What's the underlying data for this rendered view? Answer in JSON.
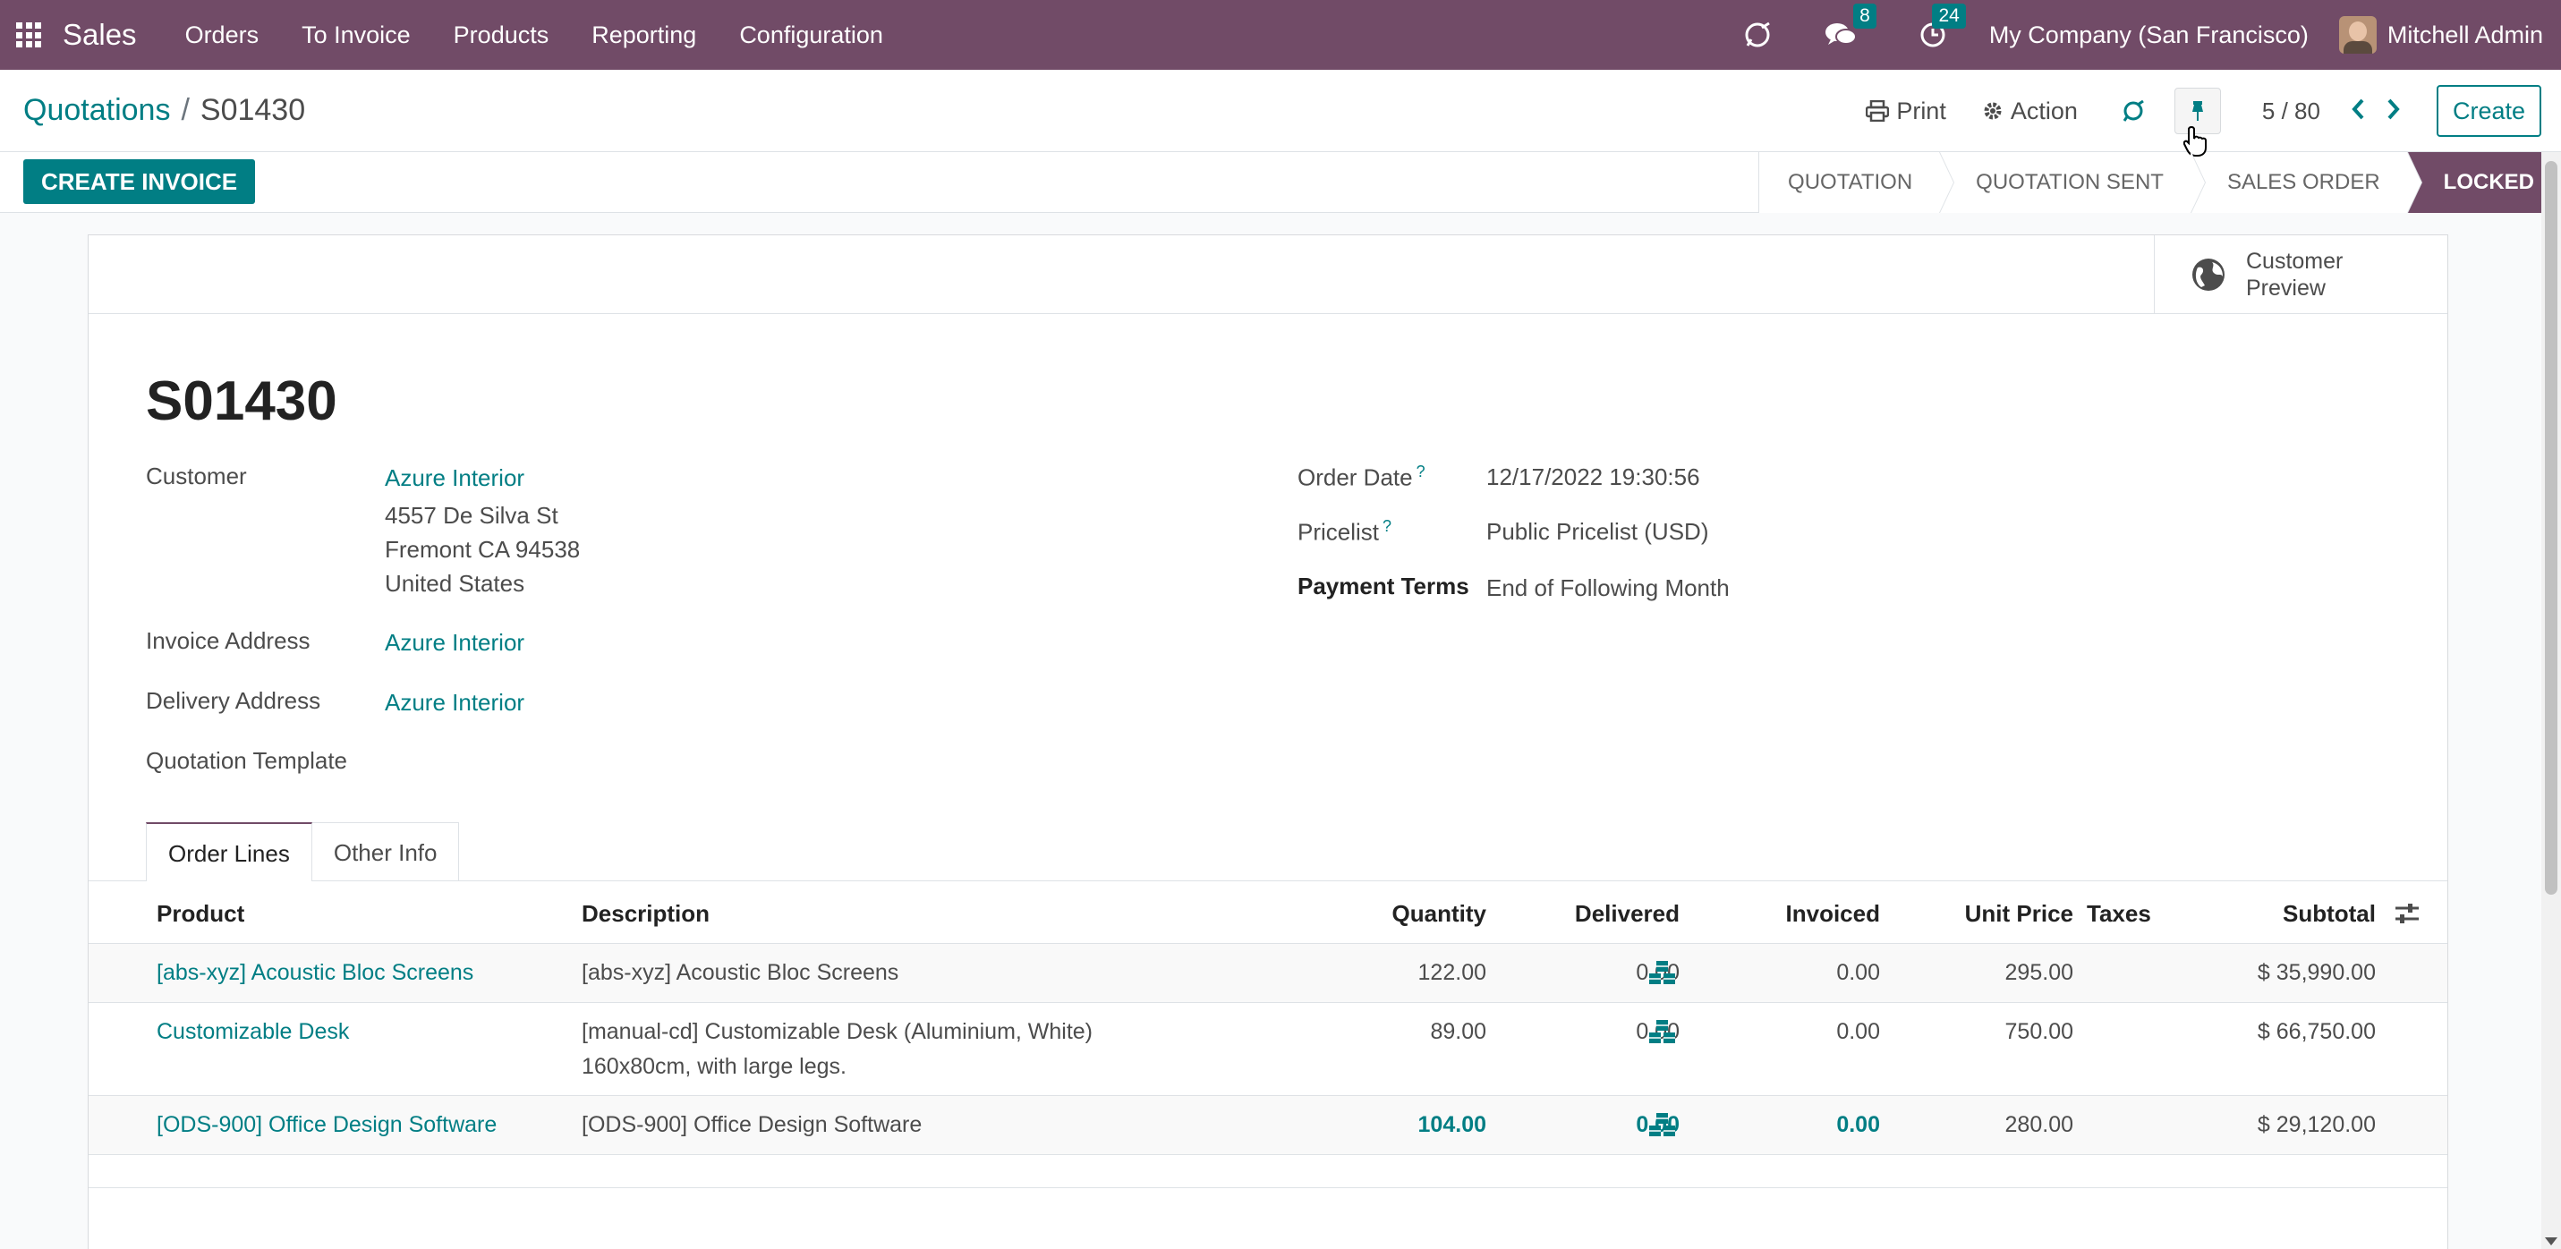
{
  "navbar": {
    "brand": "Sales",
    "menu": [
      "Orders",
      "To Invoice",
      "Products",
      "Reporting",
      "Configuration"
    ],
    "messages_count": "8",
    "activities_count": "24",
    "company": "My Company (San Francisco)",
    "user": "Mitchell Admin"
  },
  "breadcrumb": {
    "parent": "Quotations",
    "separator": "/",
    "current": "S01430"
  },
  "control": {
    "print_label": "Print",
    "action_label": "Action",
    "pager": "5 / 80",
    "create_label": "Create"
  },
  "statusbar": {
    "invoice_button": "CREATE INVOICE",
    "stages": [
      "QUOTATION",
      "QUOTATION SENT",
      "SALES ORDER",
      "LOCKED"
    ],
    "active_stage": "LOCKED"
  },
  "sheet": {
    "preview_label_1": "Customer",
    "preview_label_2": "Preview",
    "title": "S01430",
    "customer_label": "Customer",
    "customer_name": "Azure Interior",
    "address_line1": "4557 De Silva St",
    "address_line2": "Fremont CA 94538",
    "address_line3": "United States",
    "invoice_address_label": "Invoice Address",
    "invoice_address": "Azure Interior",
    "delivery_address_label": "Delivery Address",
    "delivery_address": "Azure Interior",
    "template_label": "Quotation Template",
    "order_date_label": "Order Date",
    "order_date": "12/17/2022 19:30:56",
    "pricelist_label": "Pricelist",
    "pricelist": "Public Pricelist (USD)",
    "payment_terms_label": "Payment Terms",
    "payment_terms": "End of Following Month",
    "help_mark": "?"
  },
  "tabs": [
    "Order Lines",
    "Other Info"
  ],
  "table": {
    "headers": {
      "product": "Product",
      "description": "Description",
      "quantity": "Quantity",
      "delivered": "Delivered",
      "invoiced": "Invoiced",
      "unit_price": "Unit Price",
      "taxes": "Taxes",
      "subtotal": "Subtotal"
    },
    "rows": [
      {
        "product": "[abs-xyz] Acoustic Bloc Screens",
        "description_1": "[abs-xyz] Acoustic Bloc Screens",
        "description_2": "",
        "quantity": "122.00",
        "delivered": "0.00",
        "invoiced": "0.00",
        "unit_price": "295.00",
        "subtotal": "$ 35,990.00"
      },
      {
        "product": "Customizable Desk",
        "description_1": "[manual-cd] Customizable Desk (Aluminium, White)",
        "description_2": "160x80cm, with large legs.",
        "quantity": "89.00",
        "delivered": "0.00",
        "invoiced": "0.00",
        "unit_price": "750.00",
        "subtotal": "$ 66,750.00"
      },
      {
        "product": "[ODS-900] Office Design Software",
        "description_1": "[ODS-900] Office Design Software",
        "description_2": "",
        "quantity": "104.00",
        "delivered": "0.00",
        "invoiced": "0.00",
        "unit_price": "280.00",
        "subtotal": "$ 29,120.00"
      }
    ]
  },
  "colors": {
    "brand": "#714b67",
    "accent": "#017e84"
  }
}
